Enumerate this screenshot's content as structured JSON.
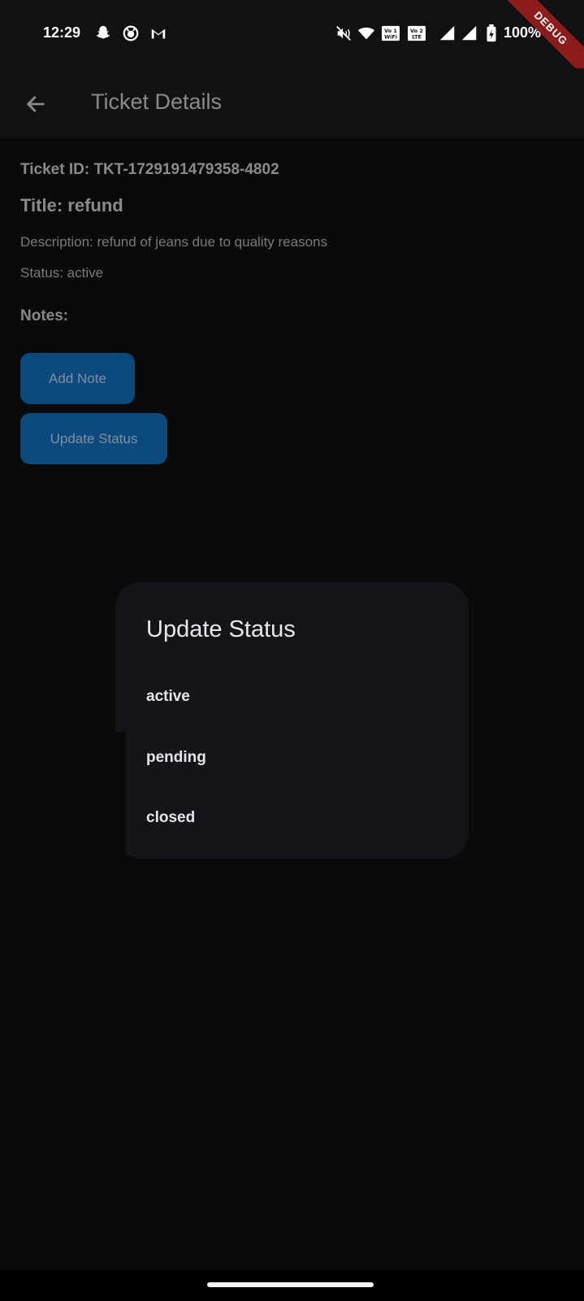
{
  "status_bar": {
    "time": "12:29",
    "battery": "100%",
    "left_icons": [
      "snapchat-icon",
      "github-icon",
      "gmail-icon"
    ],
    "right_icons": [
      "mute-icon",
      "wifi-icon",
      "vowifi-icon",
      "volte-icon",
      "signal-icon",
      "signal-icon",
      "battery-charging-icon"
    ]
  },
  "debug_banner": "DEBUG",
  "app_bar": {
    "back_icon": "arrow-left-icon",
    "title": "Ticket Details"
  },
  "ticket": {
    "id_line": "Ticket ID: TKT-1729191479358-4802",
    "title_line": "Title: refund",
    "description_line": "Description: refund of jeans due to quality reasons",
    "status_line": "Status: active",
    "notes_label": "Notes:"
  },
  "actions": {
    "add_note": "Add Note",
    "update_status": "Update Status"
  },
  "dialog": {
    "title": "Update Status",
    "options": [
      "active",
      "pending",
      "closed"
    ]
  },
  "colors": {
    "background": "#0a0a0a",
    "button": "#0c4a7e",
    "dialog": "#16141b",
    "debug": "#8c1c1c"
  }
}
